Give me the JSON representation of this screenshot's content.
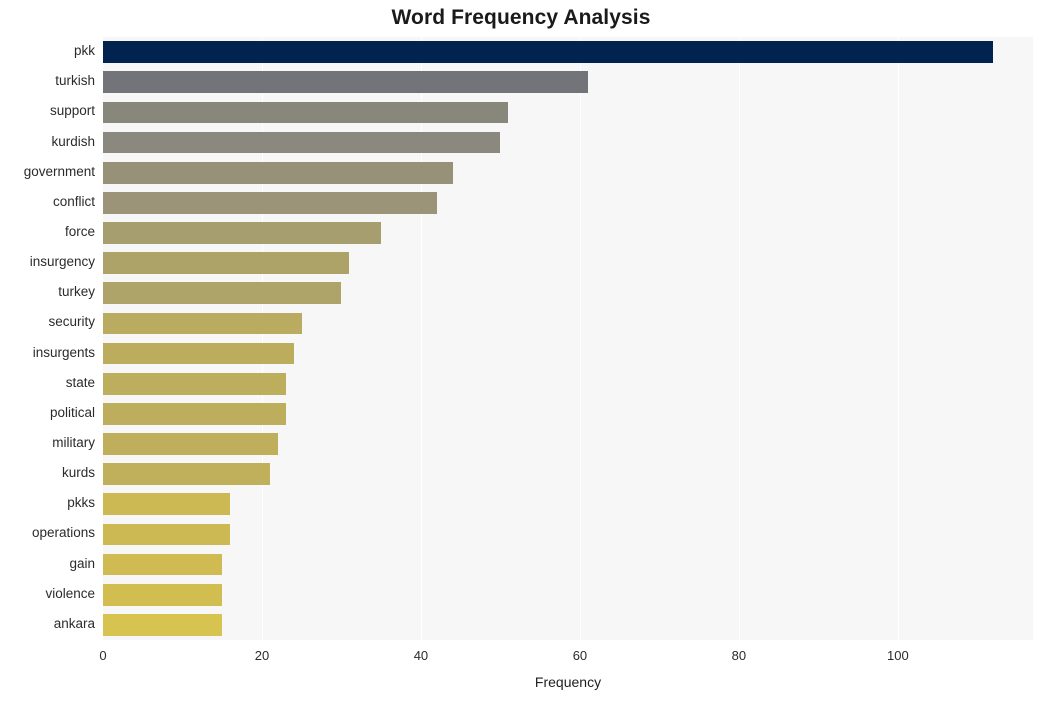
{
  "chart_data": {
    "type": "bar",
    "orientation": "horizontal",
    "title": "Word Frequency Analysis",
    "xlabel": "Frequency",
    "ylabel": "",
    "xlim": [
      0,
      117
    ],
    "xticks": [
      0,
      20,
      40,
      60,
      80,
      100
    ],
    "xticklabels": [
      "0",
      "20",
      "40",
      "60",
      "80",
      "100"
    ],
    "grid": true,
    "grid_axis": "x",
    "legend": false,
    "plot_background": "#f7f7f7",
    "figure_background": "#ffffff",
    "gridline_color": "#ffffff",
    "categories": [
      "pkk",
      "turkish",
      "support",
      "kurdish",
      "government",
      "conflict",
      "force",
      "insurgency",
      "turkey",
      "security",
      "insurgents",
      "state",
      "political",
      "military",
      "kurds",
      "pkks",
      "operations",
      "gain",
      "violence",
      "ankara"
    ],
    "values": [
      112,
      61,
      51,
      50,
      44,
      42,
      35,
      31,
      30,
      25,
      24,
      23,
      23,
      22,
      21,
      16,
      16,
      15,
      15,
      15
    ],
    "bar_colors": [
      "#012350",
      "#73747a",
      "#88877b",
      "#8b887f",
      "#979177",
      "#9b9478",
      "#a79e70",
      "#ad a368",
      "#aea469",
      "#b9ab5f",
      "#bbac5e",
      "#bdae5d",
      "#bdae5d",
      "#bfaf5c",
      "#c0b05b",
      "#cdb954",
      "#cdb954",
      "#d0bb52",
      "#d2bd51",
      "#d6c350"
    ]
  }
}
